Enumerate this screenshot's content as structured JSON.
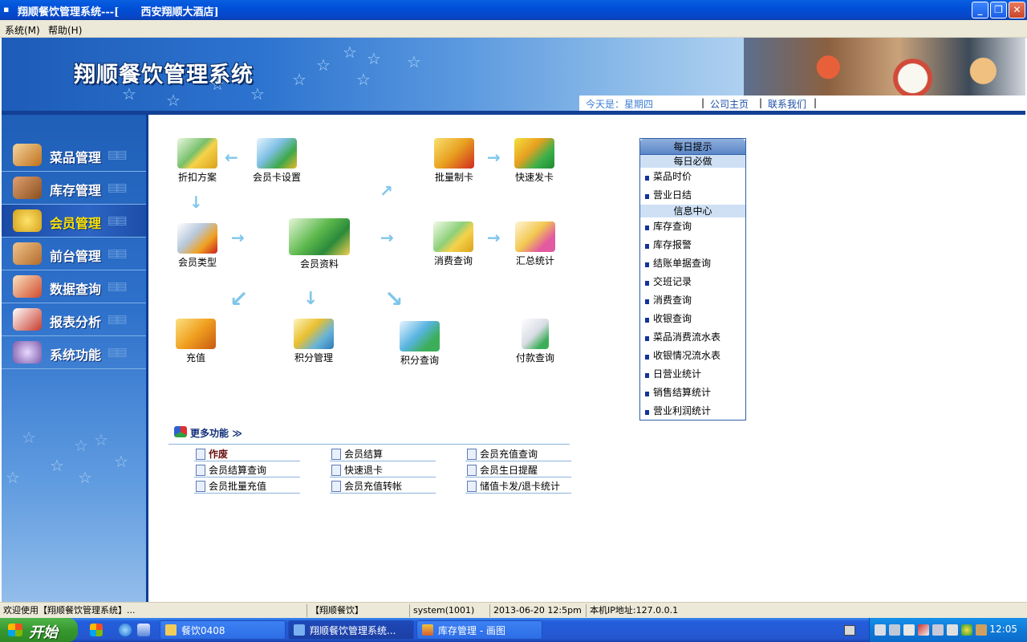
{
  "window": {
    "title": "翔顺餐饮管理系统---[      西安翔顺大酒店]",
    "minimize": "_",
    "maximize": "❐",
    "close": "✕"
  },
  "menu": [
    "系统(M)",
    "帮助(H)"
  ],
  "banner": {
    "app_name": "翔顺餐饮管理系统",
    "today": "今天是：星期四",
    "nav": [
      "公司主页",
      "联系我们"
    ],
    "sep": "|"
  },
  "sidebar": {
    "items": [
      {
        "label": "菜品管理",
        "color": "#c0701a"
      },
      {
        "label": "库存管理",
        "color": "#8a4f1c"
      },
      {
        "label": "会员管理",
        "color": "#d3a11b",
        "active": true
      },
      {
        "label": "前台管理",
        "color": "#b26c2c"
      },
      {
        "label": "数据查询",
        "color": "#d04a2c"
      },
      {
        "label": "报表分析",
        "color": "#c83a2a"
      },
      {
        "label": "系统功能",
        "color": "#7a5aa8"
      }
    ]
  },
  "flow": {
    "discount_plan": "折扣方案",
    "card_settings": "会员卡设置",
    "batch_make_card": "批量制卡",
    "quick_issue_card": "快速发卡",
    "member_type": "会员类型",
    "member_info": "会员资料",
    "consume_query": "消费查询",
    "summary_stats": "汇总统计",
    "recharge": "充值",
    "points_manage": "积分管理",
    "points_query": "积分查询",
    "payment_query": "付款查询"
  },
  "tips": {
    "header": "每日提示",
    "daily_section": "每日必做",
    "daily_items": [
      "菜品时价",
      "营业日结"
    ],
    "info_section": "信息中心",
    "info_items": [
      "库存查询",
      "库存报警",
      "结账单据查询",
      "交班记录",
      "消费查询",
      "收银查询",
      "菜品消费流水表",
      "收银情况流水表",
      "日营业统计",
      "销售结算统计",
      "营业利润统计"
    ]
  },
  "more_functions": {
    "title": "更多功能",
    "chevron": "≫",
    "items": [
      [
        "作废",
        "会员结算",
        "会员充值查询"
      ],
      [
        "会员结算查询",
        "快速退卡",
        "会员生日提醒"
      ],
      [
        "会员批量充值",
        "会员充值转帐",
        "储值卡发/退卡统计"
      ]
    ]
  },
  "status": {
    "welcome": "欢迎使用【翔顺餐饮管理系统】...",
    "brand": "【翔顺餐饮】",
    "user": "system(1001)",
    "datetime": "2013-06-20 12:5pm",
    "ip": "本机IP地址:127.0.0.1"
  },
  "taskbar": {
    "start": "开始",
    "tasks": [
      "餐饮0408",
      "翔顺餐饮管理系统...",
      "库存管理 - 画图"
    ],
    "clock": "12:05"
  }
}
